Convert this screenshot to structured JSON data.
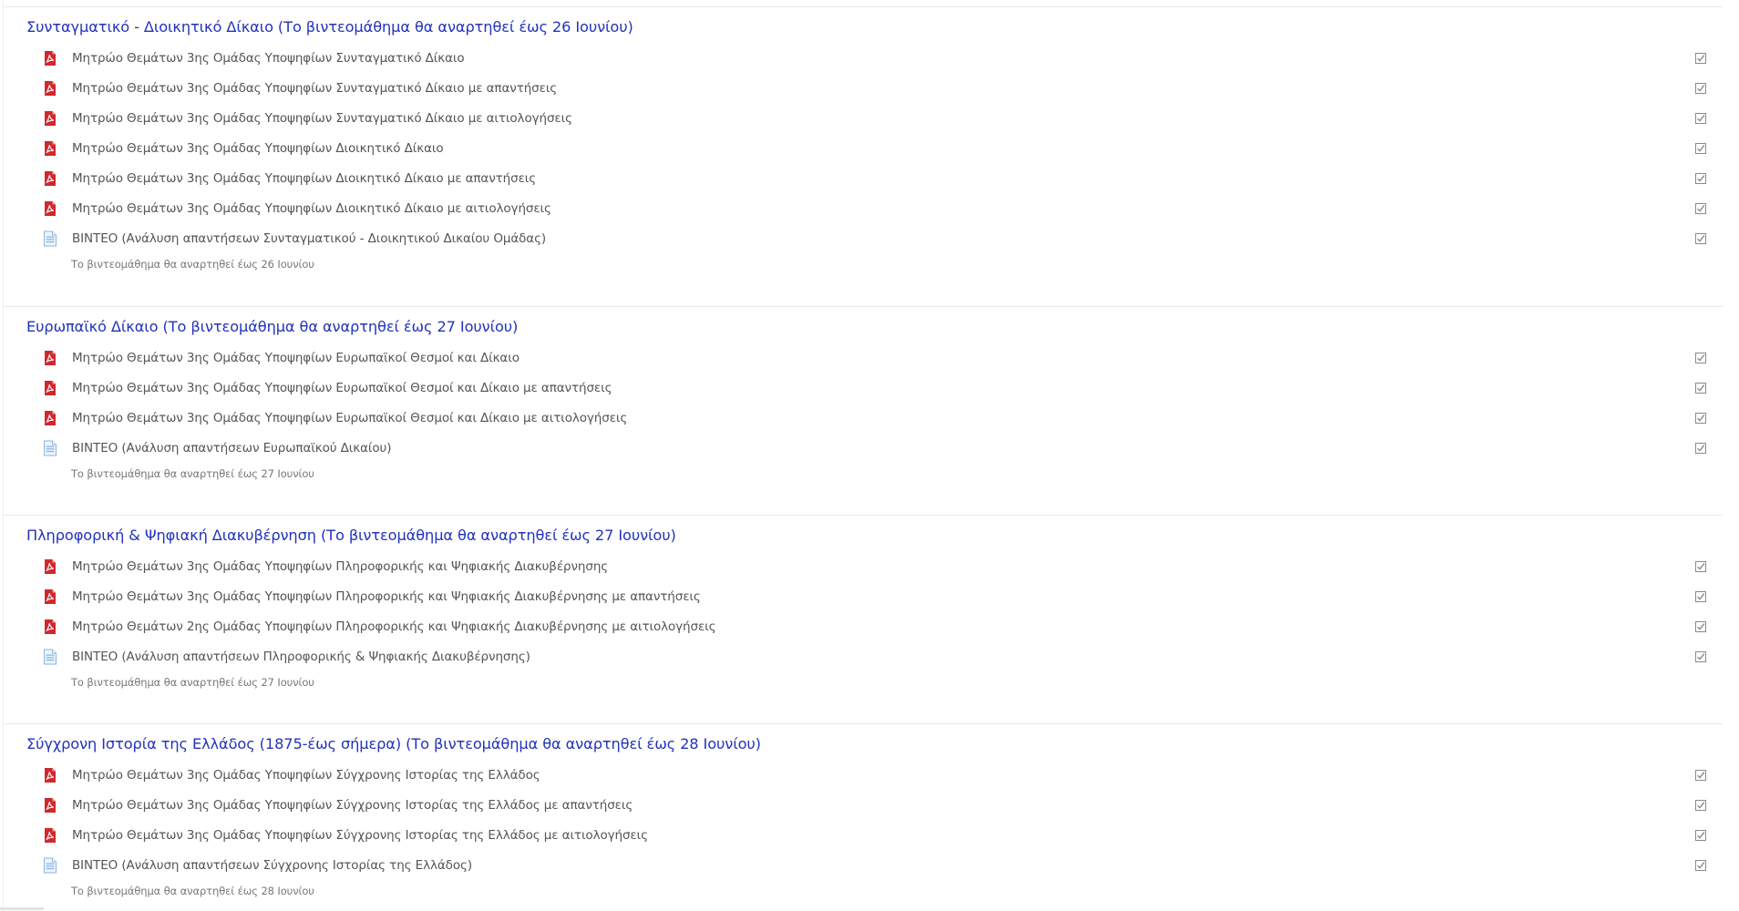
{
  "sections": [
    {
      "title": "Συνταγματικό - Διοικητικό Δίκαιο (Το βιντεομάθημα θα αναρτηθεί έως 26 Ιουνίου)",
      "activities": [
        {
          "icon": "pdf-icon",
          "label": "Μητρώο Θεμάτων 3ης Ομάδας Υποψηφίων Συνταγματικό Δίκαιο"
        },
        {
          "icon": "pdf-icon",
          "label": "Μητρώο Θεμάτων 3ης Ομάδας Υποψηφίων Συνταγματικό Δίκαιο με απαντήσεις"
        },
        {
          "icon": "pdf-icon",
          "label": "Μητρώο Θεμάτων 3ης Ομάδας Υποψηφίων Συνταγματικό Δίκαιο με αιτιολογήσεις"
        },
        {
          "icon": "pdf-icon",
          "label": "Μητρώο Θεμάτων 3ης Ομάδας Υποψηφίων Διοικητικό Δίκαιο"
        },
        {
          "icon": "pdf-icon",
          "label": "Μητρώο Θεμάτων 3ης Ομάδας Υποψηφίων Διοικητικό Δίκαιο με απαντήσεις"
        },
        {
          "icon": "pdf-icon",
          "label": "Μητρώο Θεμάτων 3ης Ομάδας Υποψηφίων Διοικητικό Δίκαιο με αιτιολογήσεις"
        },
        {
          "icon": "page-icon",
          "label": "ΒΙΝΤΕΟ (Ανάλυση απαντήσεων Συνταγματικού - Διοικητικού Δικαίου Ομάδας)"
        }
      ],
      "note": "Το βιντεομάθημα θα αναρτηθεί έως 26 Ιουνίου"
    },
    {
      "title": "Ευρωπαϊκό Δίκαιο (Το βιντεομάθημα θα αναρτηθεί έως 27 Ιουνίου)",
      "activities": [
        {
          "icon": "pdf-icon",
          "label": "Μητρώο Θεμάτων 3ης Ομάδας Υποψηφίων Ευρωπαϊκοί Θεσμοί και Δίκαιο"
        },
        {
          "icon": "pdf-icon",
          "label": "Μητρώο Θεμάτων 3ης Ομάδας Υποψηφίων Ευρωπαϊκοί Θεσμοί και Δίκαιο με απαντήσεις"
        },
        {
          "icon": "pdf-icon",
          "label": "Μητρώο Θεμάτων 3ης Ομάδας Υποψηφίων Ευρωπαϊκοί Θεσμοί και Δίκαιο με αιτιολογήσεις"
        },
        {
          "icon": "page-icon",
          "label": "ΒΙΝΤΕΟ (Ανάλυση απαντήσεων Ευρωπαϊκού Δικαίου)"
        }
      ],
      "note": "Το βιντεομάθημα θα αναρτηθεί έως 27 Ιουνίου"
    },
    {
      "title": "Πληροφορική & Ψηφιακή Διακυβέρνηση (Το βιντεομάθημα θα αναρτηθεί έως 27 Ιουνίου)",
      "activities": [
        {
          "icon": "pdf-icon",
          "label": "Μητρώο Θεμάτων 3ης Ομάδας Υποψηφίων Πληροφορικής και Ψηφιακής Διακυβέρνησης"
        },
        {
          "icon": "pdf-icon",
          "label": "Μητρώο Θεμάτων 3ης Ομάδας Υποψηφίων Πληροφορικής και Ψηφιακής Διακυβέρνησης με απαντήσεις"
        },
        {
          "icon": "pdf-icon",
          "label": "Μητρώο Θεμάτων 2ης Ομάδας Υποψηφίων Πληροφορικής και Ψηφιακής Διακυβέρνησης με αιτιολογήσεις"
        },
        {
          "icon": "page-icon",
          "label": "ΒΙΝΤΕΟ (Ανάλυση απαντήσεων Πληροφορικής & Ψηφιακής Διακυβέρνησης)"
        }
      ],
      "note": "Το βιντεομάθημα θα αναρτηθεί έως 27 Ιουνίου"
    },
    {
      "title": "Σύγχρονη Ιστορία της Ελλάδος (1875-έως σήμερα) (Το βιντεομάθημα θα αναρτηθεί έως 28 Ιουνίου)",
      "activities": [
        {
          "icon": "pdf-icon",
          "label": "Μητρώο Θεμάτων 3ης Ομάδας Υποψηφίων Σύγχρονης Ιστορίας της Ελλάδος"
        },
        {
          "icon": "pdf-icon",
          "label": "Μητρώο Θεμάτων 3ης Ομάδας Υποψηφίων Σύγχρονης Ιστορίας της Ελλάδος με απαντήσεις"
        },
        {
          "icon": "pdf-icon",
          "label": "Μητρώο Θεμάτων 3ης Ομάδας Υποψηφίων Σύγχρονης Ιστορίας της Ελλάδος με αιτιολογήσεις"
        },
        {
          "icon": "page-icon",
          "label": "ΒΙΝΤΕΟ (Ανάλυση απαντήσεων Σύγχρονης Ιστορίας της Ελλάδος)"
        }
      ],
      "note": "Το βιντεομάθημα θα αναρτηθεί έως 28 Ιουνίου"
    }
  ],
  "colors": {
    "section_title": "#2233bb",
    "activity_text": "#555555",
    "note_text": "#777777",
    "pdf_icon": "#d0282e",
    "page_icon": "#8ab6e0",
    "checkbox": "#8a8a8a"
  }
}
